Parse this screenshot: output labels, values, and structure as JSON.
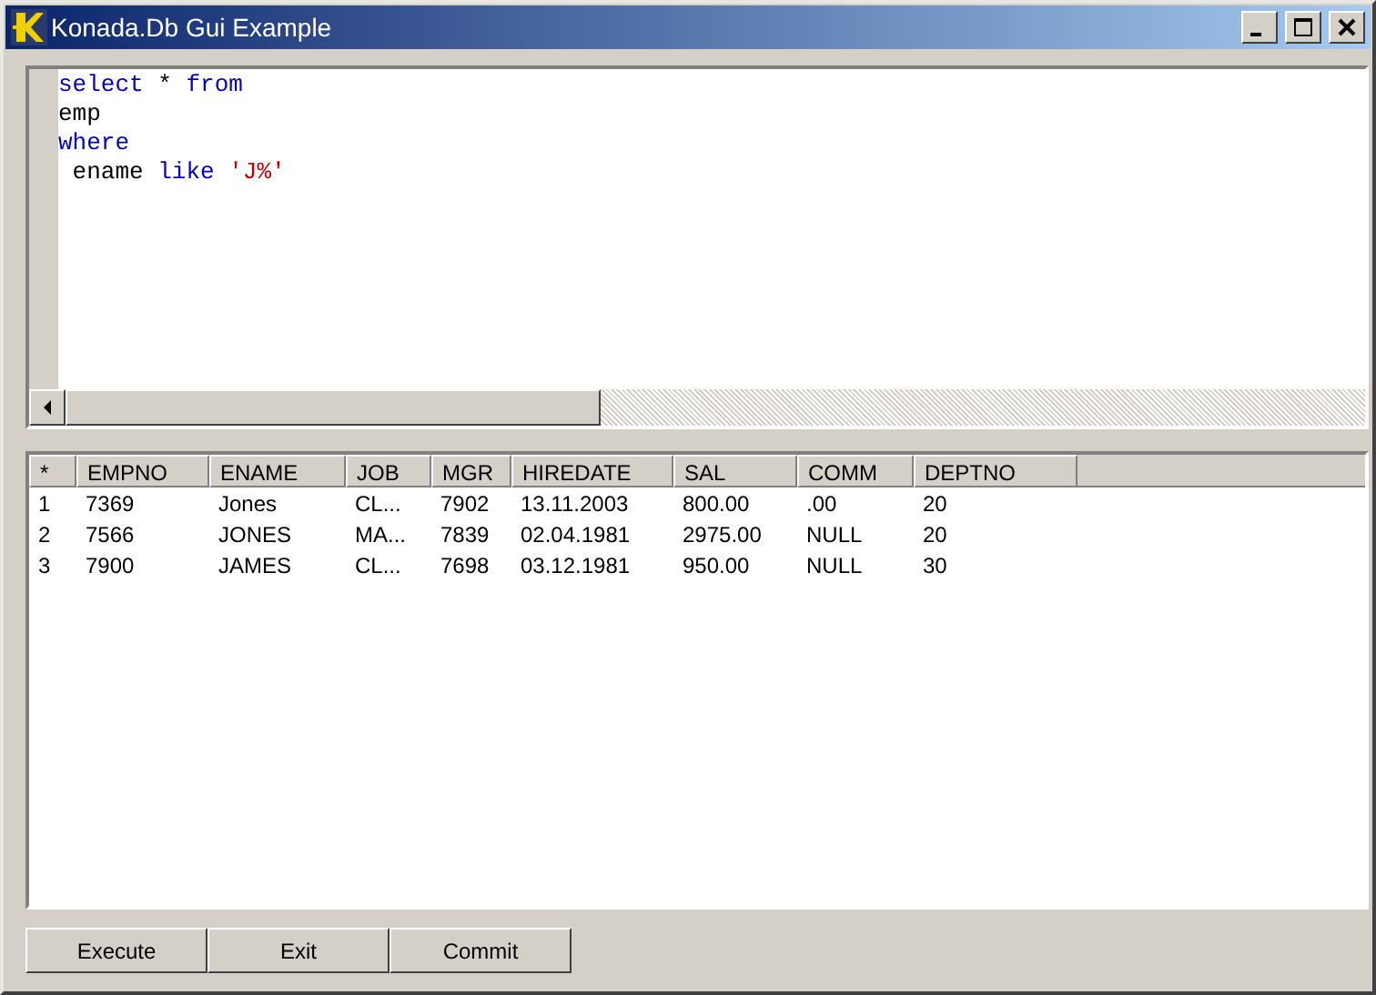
{
  "window": {
    "title": "Konada.Db Gui Example"
  },
  "editor": {
    "lines": [
      [
        {
          "kind": "keyword",
          "text": "select"
        },
        {
          "kind": "plain",
          "text": " * "
        },
        {
          "kind": "keyword",
          "text": "from"
        }
      ],
      [
        {
          "kind": "plain",
          "text": "emp"
        }
      ],
      [
        {
          "kind": "keyword",
          "text": "where"
        }
      ],
      [
        {
          "kind": "plain",
          "text": " ename "
        },
        {
          "kind": "keyword",
          "text": "like"
        },
        {
          "kind": "string",
          "text": " 'J%'"
        }
      ]
    ]
  },
  "table": {
    "columns": [
      "*",
      "EMPNO",
      "ENAME",
      "JOB",
      "MGR",
      "HIREDATE",
      "SAL",
      "COMM",
      "DEPTNO"
    ],
    "rows": [
      [
        "1",
        "7369",
        "Jones",
        "CL...",
        "7902",
        "13.11.2003",
        "800.00",
        ".00",
        "20"
      ],
      [
        "2",
        "7566",
        "JONES",
        "MA...",
        "7839",
        "02.04.1981",
        "2975.00",
        "NULL",
        "20"
      ],
      [
        "3",
        "7900",
        "JAMES",
        "CL...",
        "7698",
        "03.12.1981",
        "950.00",
        "NULL",
        "30"
      ]
    ]
  },
  "buttons": [
    "Execute",
    "Exit",
    "Commit"
  ]
}
